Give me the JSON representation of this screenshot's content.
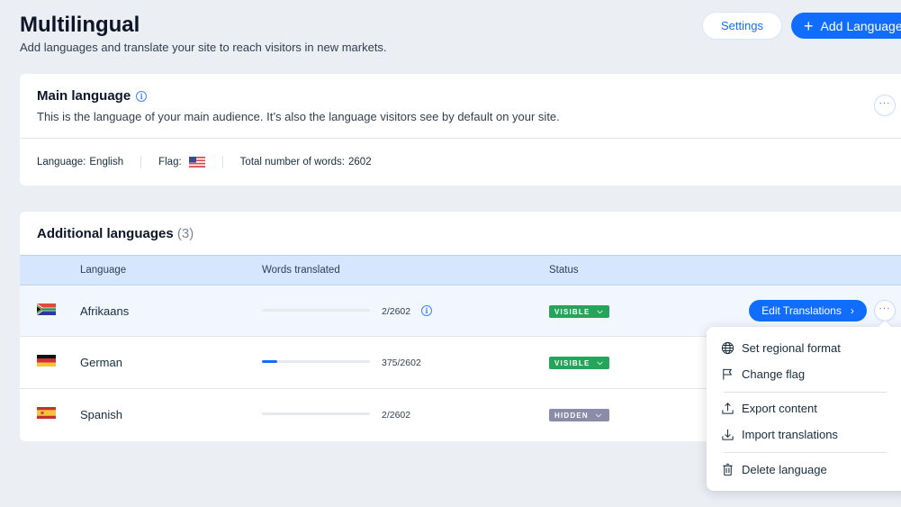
{
  "header": {
    "title": "Multilingual",
    "subtitle": "Add languages and translate your site to reach visitors in new markets.",
    "settings_label": "Settings",
    "add_language_label": "Add Language"
  },
  "main_language": {
    "title": "Main language",
    "description": "This is the language of your main audience. It’s also the language visitors see by default on your site.",
    "language_label": "Language:",
    "language_value": "English",
    "flag_label": "Flag:",
    "flag_icon": "us-flag",
    "words_label": "Total number of words:",
    "words_value": "2602"
  },
  "additional_languages": {
    "title": "Additional languages",
    "count": "(3)",
    "columns": [
      "Language",
      "Words translated",
      "Status"
    ],
    "rows": [
      {
        "flag_icon": "south-africa-flag",
        "language": "Afrikaans",
        "translated": 2,
        "total": 2602,
        "words": "2/2602",
        "status": "VISIBLE",
        "status_color": "#25a55a",
        "show_info": true
      },
      {
        "flag_icon": "germany-flag",
        "language": "German",
        "translated": 375,
        "total": 2602,
        "words": "375/2602",
        "status": "VISIBLE",
        "status_color": "#25a55a",
        "show_info": false
      },
      {
        "flag_icon": "spain-flag",
        "language": "Spanish",
        "translated": 2,
        "total": 2602,
        "words": "2/2602",
        "status": "HIDDEN",
        "status_color": "#8a8ca8",
        "show_info": false
      }
    ],
    "edit_translations_label": "Edit Translations"
  },
  "context_menu": {
    "items": [
      {
        "label": "Set regional format",
        "icon": "globe-icon"
      },
      {
        "label": "Change flag",
        "icon": "flag-icon"
      },
      {
        "label": "Export content",
        "icon": "export-icon"
      },
      {
        "label": "Import translations",
        "icon": "import-icon"
      },
      {
        "label": "Delete language",
        "icon": "trash-icon"
      }
    ]
  },
  "colors": {
    "accent": "#116dff",
    "background": "#ebeef3",
    "table_header": "#d6e6fe",
    "visible": "#25a55a",
    "hidden": "#8a8ca8"
  }
}
